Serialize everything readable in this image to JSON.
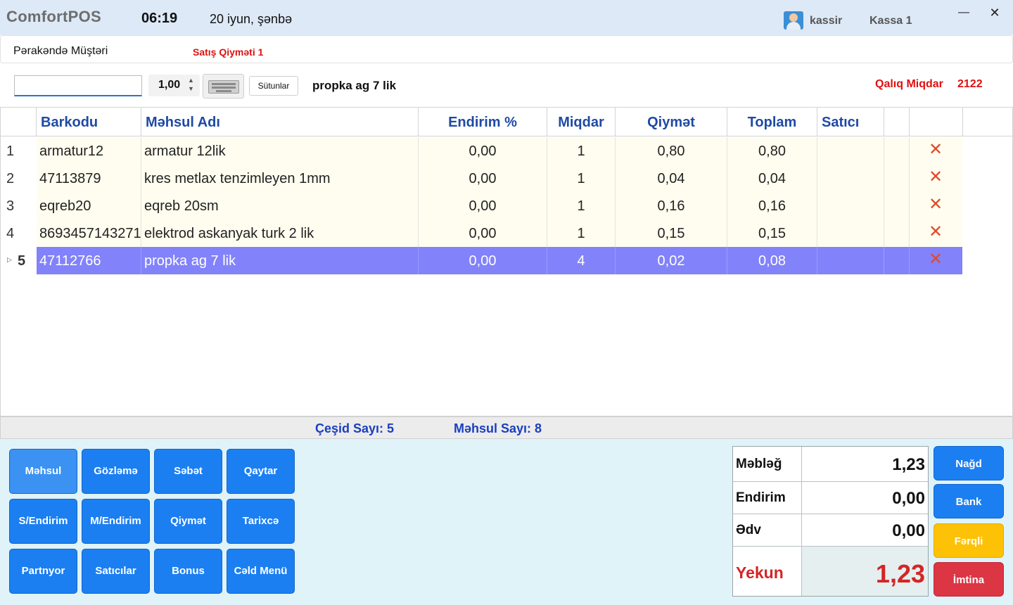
{
  "header": {
    "app_title": "ComfortPOS",
    "time": "06:19",
    "date": "20 iyun, şənbə",
    "user": "kassir",
    "register": "Kassa 1",
    "minimize_glyph": "—",
    "close_glyph": "✕"
  },
  "customer": {
    "name": "Pərakəndə Müştəri",
    "price_type": "Satış Qiyməti 1"
  },
  "toolbar": {
    "barcode_value": "",
    "quantity": "1,00",
    "columns_label": "Sütunlar",
    "selected_product": "propka ag 7 lik",
    "stock_label": "Qalıq Miqdar",
    "stock_value": "2122"
  },
  "grid": {
    "columns": [
      "Barkodu",
      "Məhsul Adı",
      "Endirim %",
      "Miqdar",
      "Qiymət",
      "Toplam",
      "Satıcı"
    ],
    "rows": [
      {
        "num": "1",
        "barcode": "armatur12",
        "name": "armatur 12lik",
        "discount": "0,00",
        "qty": "1",
        "price": "0,80",
        "total": "0,80",
        "seller": ""
      },
      {
        "num": "2",
        "barcode": "47113879",
        "name": "kres metlax tenzimleyen 1mm",
        "discount": "0,00",
        "qty": "1",
        "price": "0,04",
        "total": "0,04",
        "seller": ""
      },
      {
        "num": "3",
        "barcode": "eqreb20",
        "name": "eqreb 20sm",
        "discount": "0,00",
        "qty": "1",
        "price": "0,16",
        "total": "0,16",
        "seller": ""
      },
      {
        "num": "4",
        "barcode": "8693457143271",
        "name": "elektrod askanyak turk 2 lik",
        "discount": "0,00",
        "qty": "1",
        "price": "0,15",
        "total": "0,15",
        "seller": ""
      },
      {
        "num": "5",
        "barcode": "47112766",
        "name": "propka ag 7 lik",
        "discount": "0,00",
        "qty": "4",
        "price": "0,02",
        "total": "0,08",
        "seller": ""
      }
    ],
    "selected_row": 5,
    "delete_glyph": "✕"
  },
  "summary": {
    "variety_count": "Çeşid Sayı: 5",
    "product_count": "Məhsul Sayı: 8"
  },
  "function_buttons": [
    "Məhsul",
    "Gözləmə",
    "Səbət",
    "Qaytar",
    "S/Endirim",
    "M/Endirim",
    "Qiymət",
    "Tarixcə",
    "Partnyor",
    "Satıcılar",
    "Bonus",
    "Cəld Menü"
  ],
  "totals": {
    "amount_label": "Məbləğ",
    "amount": "1,23",
    "discount_label": "Endirim",
    "discount": "0,00",
    "vat_label": "Ədv",
    "vat": "0,00",
    "final_label": "Yekun",
    "final": "1,23"
  },
  "payment_buttons": {
    "cash": "Nağd",
    "bank": "Bank",
    "mixed": "Fərqli",
    "cancel": "İmtina"
  },
  "colors": {
    "accent_blue": "#1b7ff2",
    "selected_row": "#8282fb",
    "alert_red": "#e01010",
    "header_text": "#1e4aa6"
  }
}
